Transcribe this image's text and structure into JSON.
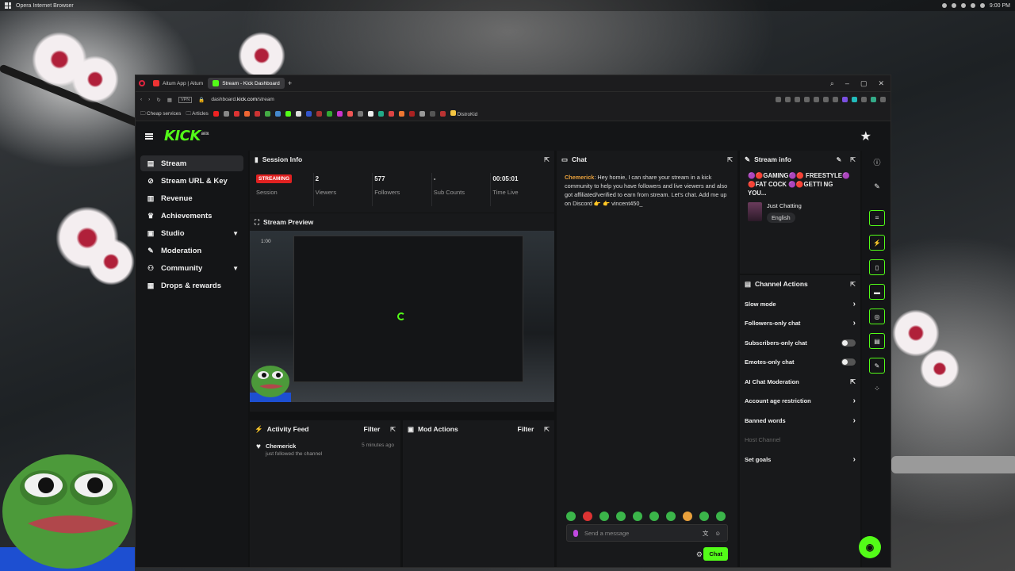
{
  "os": {
    "browser_title": "Opera Internet Browser",
    "clock": "9:00 PM"
  },
  "browser": {
    "tabs": [
      {
        "label": "Aitum App | Aitum"
      },
      {
        "label": "Stream - Kick Dashboard"
      }
    ],
    "url_prefix": "dashboard.",
    "url_domain": "kick.com",
    "url_path": "/stream",
    "vpn": "VPN",
    "bookmarks": {
      "cheap": "Cheap services",
      "articles": "Articles",
      "distrokid": "DistroKid"
    }
  },
  "kick": {
    "logo": "KICK",
    "beta": "BETA"
  },
  "sidebar": {
    "items": [
      {
        "label": "Stream"
      },
      {
        "label": "Stream URL & Key"
      },
      {
        "label": "Revenue"
      },
      {
        "label": "Achievements"
      },
      {
        "label": "Studio"
      },
      {
        "label": "Moderation"
      },
      {
        "label": "Community"
      },
      {
        "label": "Drops & rewards"
      }
    ]
  },
  "session": {
    "title": "Session Info",
    "status": "STREAMING",
    "stats": [
      {
        "value": "",
        "label": "Session"
      },
      {
        "value": "2",
        "label": "Viewers"
      },
      {
        "value": "577",
        "label": "Followers"
      },
      {
        "value": "-",
        "label": "Sub Counts"
      },
      {
        "value": "00:05:01",
        "label": "Time Live"
      }
    ]
  },
  "preview": {
    "title": "Stream Preview",
    "overlay_time": "1:00"
  },
  "activity": {
    "title": "Activity Feed",
    "filter": "Filter",
    "items": [
      {
        "user": "Chemerick",
        "action": "just followed the channel",
        "time": "5 minutes ago"
      }
    ]
  },
  "mod": {
    "title": "Mod Actions",
    "filter": "Filter"
  },
  "chat": {
    "title": "Chat",
    "messages": [
      {
        "user": "Chemerick",
        "text": ": Hey homie, I can share your stream in a kick community to help you have followers and live viewers and also got affiliated/verified to earn from stream. Let's chat. Add me up on Discord 👉 👉 vincent450_"
      }
    ],
    "placeholder": "Send a message",
    "send": "Chat"
  },
  "stream_info": {
    "title": "Stream info",
    "stream_title": "🟣🔴GAMING🟣🔴 FREESTYLE🟣🔴FAT COCK 🟣🔴GETTI NG YOU...",
    "category": "Just Chatting",
    "language": "English"
  },
  "channel_actions": {
    "title": "Channel Actions",
    "items": [
      {
        "label": "Slow mode"
      },
      {
        "label": "Followers-only chat"
      },
      {
        "label": "Subscribers-only chat"
      },
      {
        "label": "Emotes-only chat"
      },
      {
        "label": "AI Chat Moderation"
      },
      {
        "label": "Account age restriction"
      },
      {
        "label": "Banned words"
      },
      {
        "label": "Host Channel"
      },
      {
        "label": "Set goals"
      }
    ]
  },
  "colors": {
    "accent": "#53fc18",
    "live": "#e02121"
  }
}
